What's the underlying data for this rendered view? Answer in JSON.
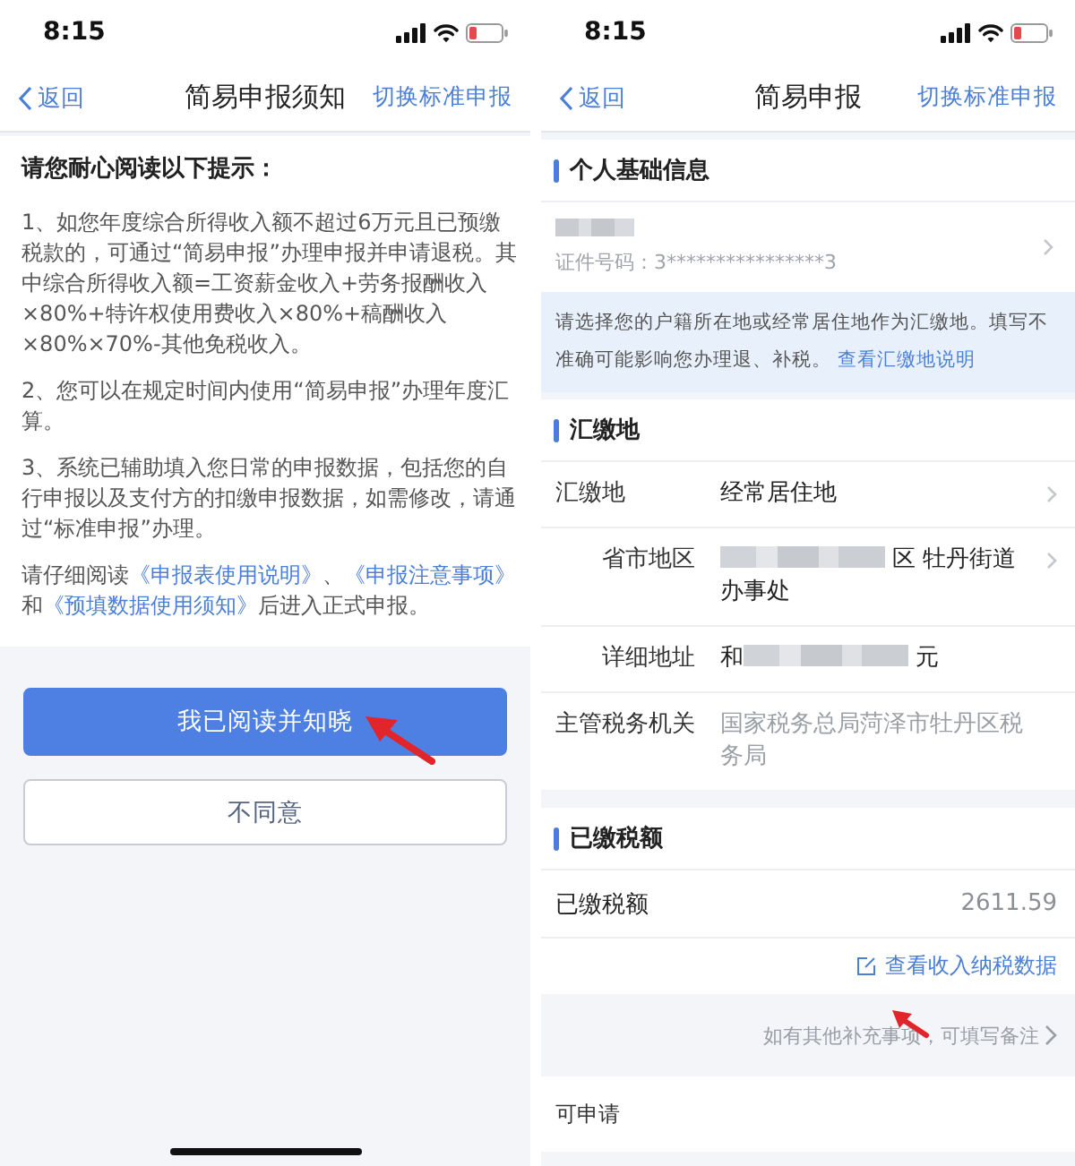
{
  "left_screen": {
    "status_bar": {
      "time": "8:15"
    },
    "nav_bar": {
      "back": "返回",
      "title": "简易申报须知",
      "action": "切换标准申报"
    },
    "notice": {
      "heading": "请您耐心阅读以下提示：",
      "paragraphs": [
        "1、如您年度综合所得收入额不超过6万元且已预缴税款的，可通过“简易申报”办理申报并申请退税。其中综合所得收入额=工资薪金收入+劳务报酬收入×80%+特许权使用费收入×80%+稿酬收入×80%×70%-其他免税收入。",
        "2、您可以在规定时间内使用“简易申报”办理年度汇算。",
        "3、系统已辅助填入您日常的申报数据，包括您的自行申报以及支付方的扣缴申报数据，如需修改，请通过“标准申报”办理。"
      ],
      "closing": [
        {
          "kind": "text",
          "text": "请仔细阅读"
        },
        {
          "kind": "link",
          "text": "《申报表使用说明》"
        },
        {
          "kind": "text",
          "text": "、"
        },
        {
          "kind": "link",
          "text": "《申报注意事项》"
        },
        {
          "kind": "text",
          "text": "和"
        },
        {
          "kind": "link",
          "text": "《预填数据使用须知》"
        },
        {
          "kind": "text",
          "text": "后进入正式申报。"
        }
      ]
    },
    "buttons": [
      {
        "label": "我已阅读并知晓",
        "kind": "primary"
      },
      {
        "label": "不同意",
        "kind": "secondary"
      }
    ]
  },
  "right_screen": {
    "status_bar": {
      "time": "8:15"
    },
    "nav_bar": {
      "back": "返回",
      "title": "简易申报",
      "action": "切换标准申报"
    },
    "personal_info": {
      "heading": "个人基础信息",
      "id_number": "证件号码：3****************3"
    },
    "hint": {
      "text": "请选择您的户籍所在地或经常居住地作为汇缴地。填写不准确可能影响您办理退、补税。",
      "link": "查看汇缴地说明"
    },
    "remit_place": {
      "heading": "汇缴地",
      "rows": [
        {
          "label": "汇缴地",
          "indented": false,
          "muted": false,
          "chevron": true,
          "value": [
            {
              "kind": "text",
              "text": "经常居住地"
            }
          ]
        },
        {
          "label": "省市地区",
          "indented": true,
          "muted": false,
          "chevron": true,
          "value": [
            {
              "kind": "redacted"
            },
            {
              "kind": "text",
              "text": "区 牡丹街道办事处"
            }
          ]
        },
        {
          "label": "详细地址",
          "indented": true,
          "muted": false,
          "chevron": false,
          "value": [
            {
              "kind": "text",
              "text": "和"
            },
            {
              "kind": "redacted"
            },
            {
              "kind": "text",
              "text": "元"
            }
          ]
        },
        {
          "label": "主管税务机关",
          "indented": false,
          "muted": true,
          "chevron": false,
          "value": [
            {
              "kind": "text",
              "text": "国家税务总局菏泽市牡丹区税务局"
            }
          ]
        }
      ]
    },
    "paid_tax": {
      "heading": "已缴税额",
      "rows": [
        {
          "label": "已缴税额",
          "value": "2611.59"
        }
      ],
      "link": "查看收入纳税数据"
    },
    "remark": "如有其他补充事项，可填写备注",
    "bottom_row": {
      "label": "可申请"
    }
  }
}
